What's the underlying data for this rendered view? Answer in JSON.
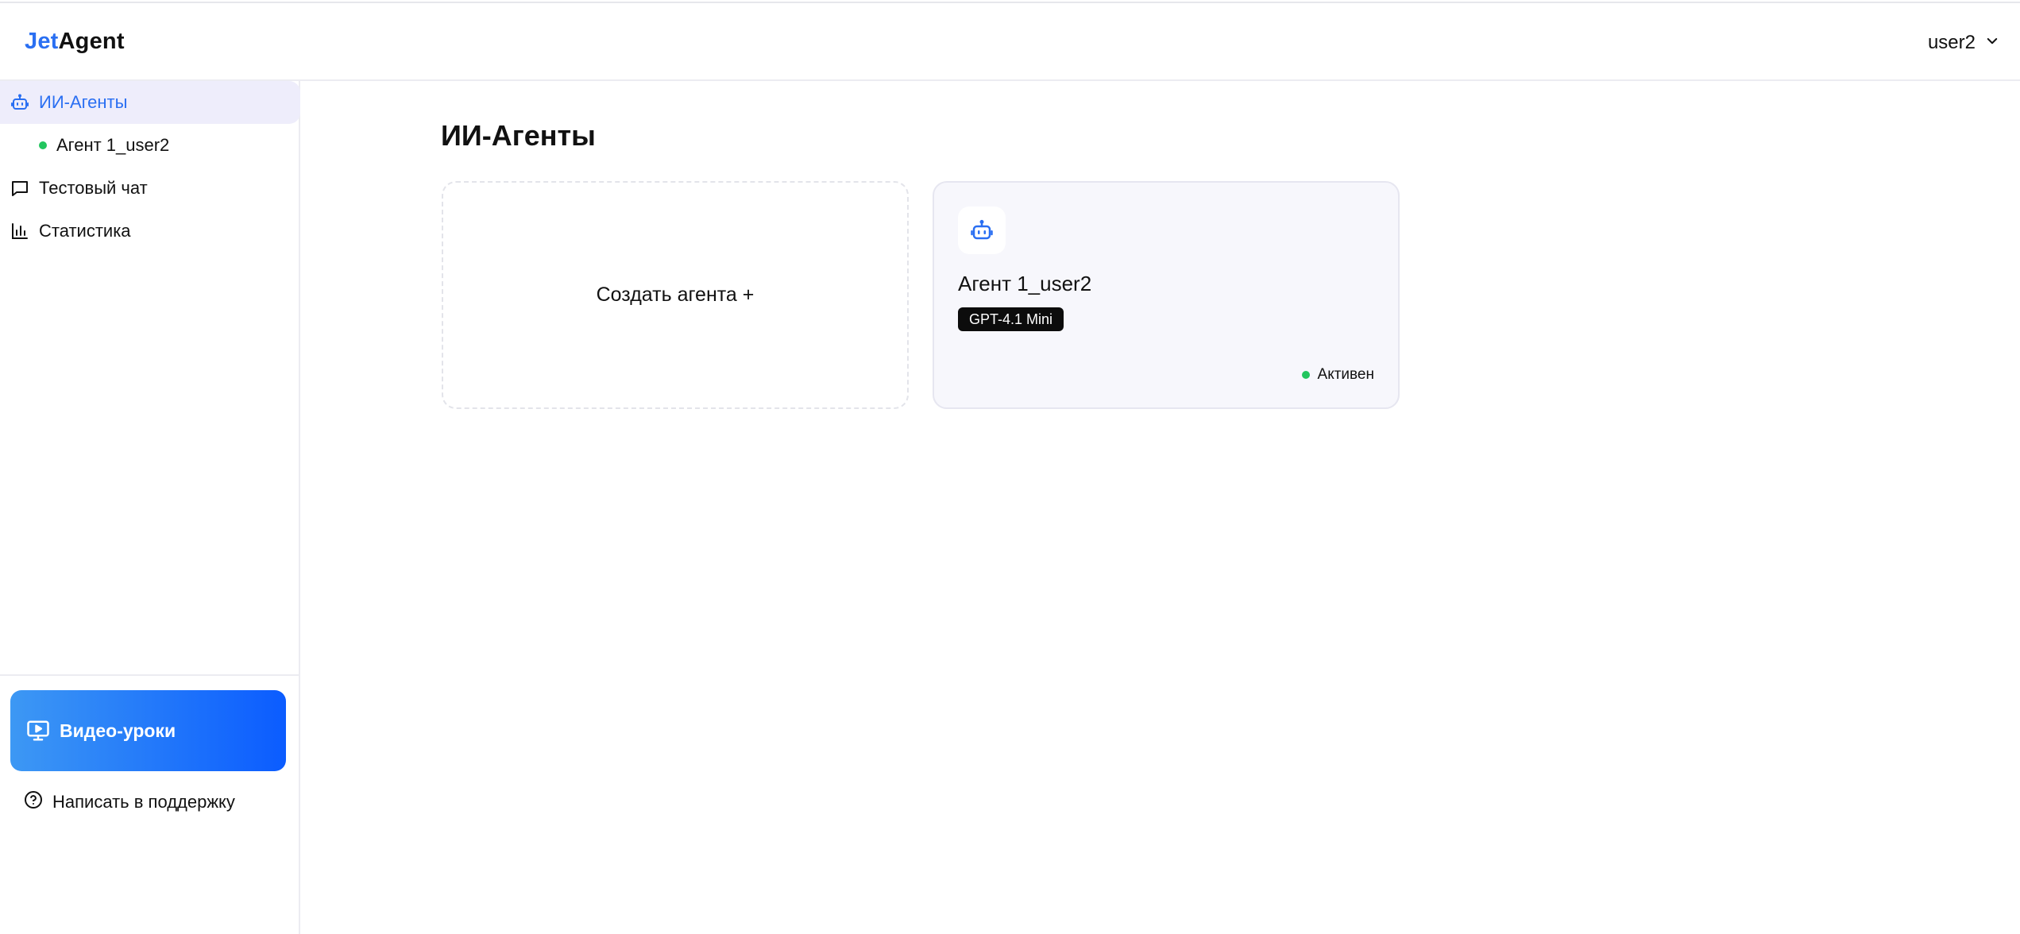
{
  "header": {
    "logo_part1": "Jet",
    "logo_part2": "Agent",
    "user_name": "user2"
  },
  "sidebar": {
    "items": [
      {
        "label": "ИИ-Агенты",
        "icon": "robot-icon",
        "active": true
      },
      {
        "label": "Агент 1_user2",
        "icon": "status-dot",
        "sub": true
      },
      {
        "label": "Тестовый чат",
        "icon": "chat-icon"
      },
      {
        "label": "Статистика",
        "icon": "bar-chart-icon"
      }
    ],
    "video_button": "Видео-уроки",
    "support_link": "Написать в поддержку"
  },
  "main": {
    "title": "ИИ-Агенты",
    "create_card_label": "Создать агента +",
    "agents": [
      {
        "name": "Агент 1_user2",
        "model": "GPT-4.1 Mini",
        "status": "Активен"
      }
    ]
  },
  "colors": {
    "brand_blue": "#2a6ff2",
    "active_bg": "#eeedfb",
    "status_green": "#22c55e",
    "video_gradient_start": "#3d98f4",
    "video_gradient_end": "#0b5cff"
  }
}
